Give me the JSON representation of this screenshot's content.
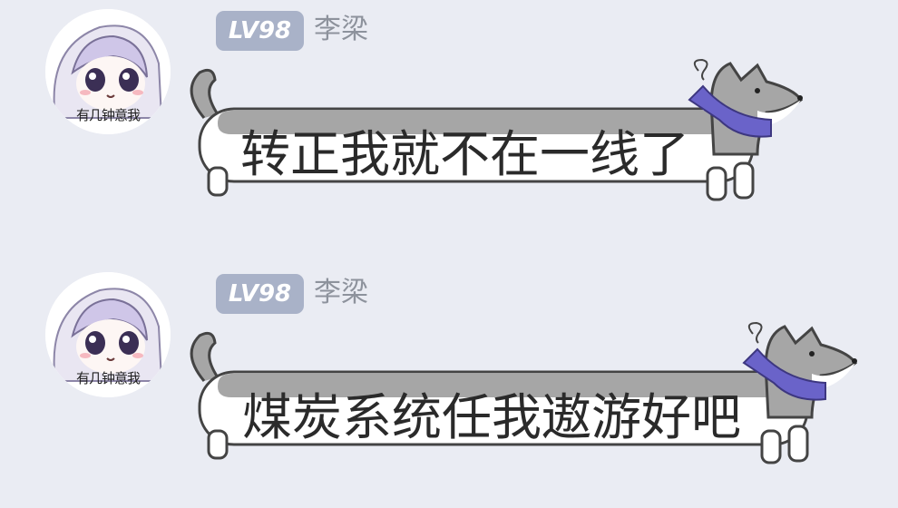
{
  "messages": [
    {
      "level_badge": "LV98",
      "sender_name": "李梁",
      "avatar_caption": "有几钟意我",
      "sticker_text": "转正我就不在一线了",
      "sticker_icons": [
        "dog-icon",
        "confused-squiggle-icon",
        "purple-scarf-icon"
      ]
    },
    {
      "level_badge": "LV98",
      "sender_name": "李梁",
      "avatar_caption": "有几钟意我",
      "sticker_text": "煤炭系统任我遨游好吧",
      "sticker_icons": [
        "dog-icon",
        "confused-squiggle-icon",
        "purple-scarf-icon"
      ]
    }
  ],
  "colors": {
    "background": "#eaecf3",
    "level_badge": "#a9b2c8",
    "sender_name": "#8d929c",
    "scarf": "#6a63c9",
    "dog_grey": "#9a9a9a"
  }
}
